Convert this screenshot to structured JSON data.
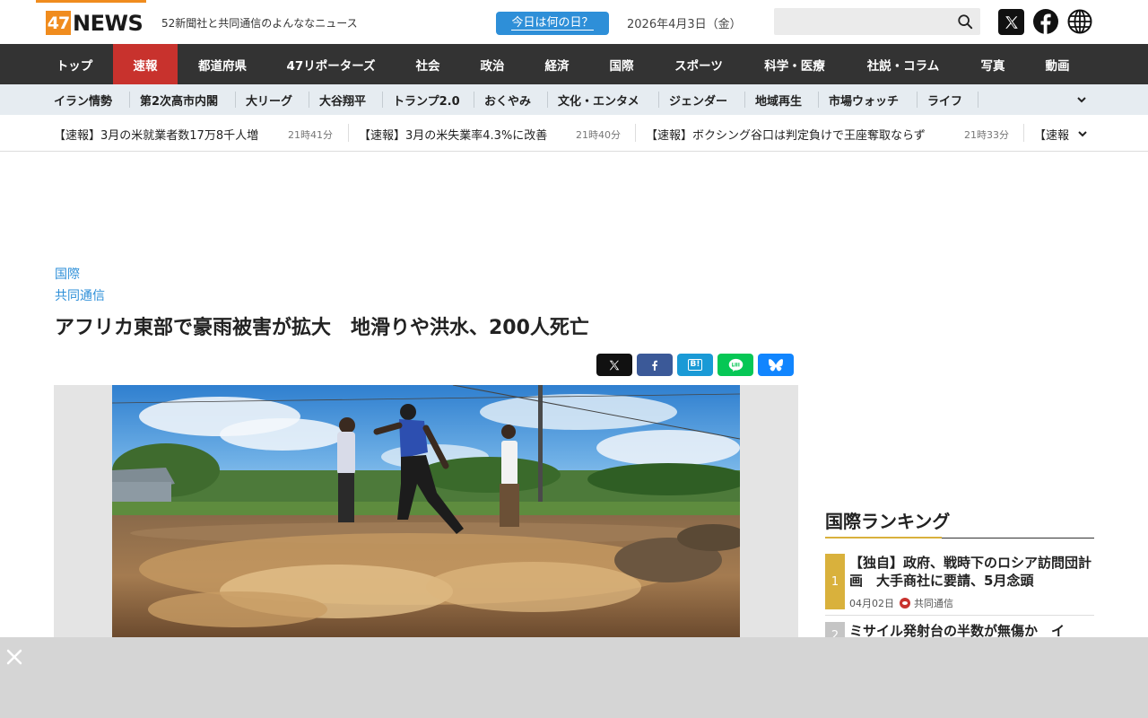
{
  "header": {
    "logo_num": "47",
    "logo_text": "NEWS",
    "tagline": "52新聞社と共同通信のよんななニュース",
    "today_button": "今日は何の日？",
    "date": "2026年4月3日（金）",
    "search_placeholder": ""
  },
  "mainnav": {
    "items": [
      {
        "label": "トップ"
      },
      {
        "label": "速報"
      },
      {
        "label": "都道府県"
      },
      {
        "label": "47リポーターズ"
      },
      {
        "label": "社会"
      },
      {
        "label": "政治"
      },
      {
        "label": "経済"
      },
      {
        "label": "国際"
      },
      {
        "label": "スポーツ"
      },
      {
        "label": "科学・医療"
      },
      {
        "label": "社説・コラム"
      },
      {
        "label": "写真"
      },
      {
        "label": "動画"
      }
    ],
    "active_color": "#c8322d"
  },
  "subnav": {
    "items": [
      {
        "label": "イラン情勢"
      },
      {
        "label": "第2次高市内閣"
      },
      {
        "label": "大リーグ"
      },
      {
        "label": "大谷翔平"
      },
      {
        "label": "トランプ2.0"
      },
      {
        "label": "おくやみ"
      },
      {
        "label": "文化・エンタメ"
      },
      {
        "label": "ジェンダー"
      },
      {
        "label": "地域再生"
      },
      {
        "label": "市場ウォッチ"
      },
      {
        "label": "ライフ"
      }
    ]
  },
  "ticker": {
    "items": [
      {
        "text": "【速報】3月の米就業者数17万8千人増",
        "time": "21時41分"
      },
      {
        "text": "【速報】3月の米失業率4.3%に改善",
        "time": "21時40分"
      },
      {
        "text": "【速報】ボクシング谷口は判定負けで王座奪取ならず",
        "time": "21時33分"
      },
      {
        "text": "【速報",
        "time": ""
      }
    ]
  },
  "article": {
    "category": "国際",
    "source": "共同通信",
    "title": "アフリカ東部で豪雨被害が拡大　地滑りや洪水、200人死亡",
    "share": {
      "hatena": "B!"
    }
  },
  "ranking": {
    "title": "国際ランキング",
    "items": [
      {
        "rank": "1",
        "title": "【独自】政府、戦時下のロシア訪問団計画　大手商社に要請、5月念頭",
        "date": "04月02日",
        "source": "共同通信"
      },
      {
        "rank": "2",
        "title": "ミサイル発射台の半数が無傷か　イ",
        "date": "",
        "source": ""
      }
    ]
  },
  "colors": {
    "brand_orange": "#f08c1e",
    "accent_blue": "#2e8fd8",
    "nav_dark": "#333333",
    "rank_gold": "#d9b13c"
  }
}
